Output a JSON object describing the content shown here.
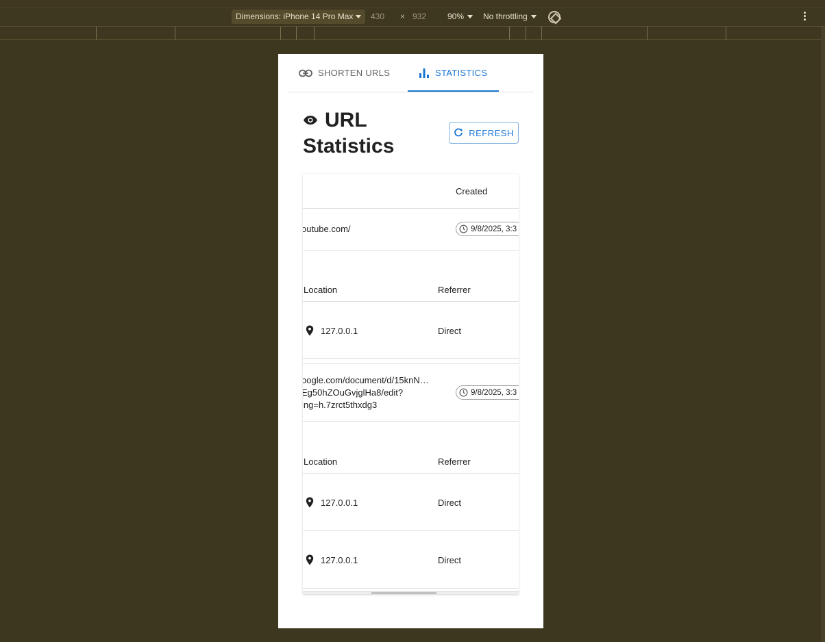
{
  "devtools": {
    "dimensions_label": "Dimensions: iPhone 14 Pro Max",
    "width": "430",
    "times": "×",
    "height": "932",
    "zoom": "90%",
    "throttling": "No throttling"
  },
  "tabs": [
    {
      "label": "SHORTEN URLS",
      "icon": "link-icon"
    },
    {
      "label": "STATISTICS",
      "icon": "bar-chart-icon",
      "active": true
    }
  ],
  "page": {
    "title": "URL Statistics",
    "refresh_label": "REFRESH"
  },
  "table": {
    "header_created": "Created",
    "urls": [
      {
        "original_lines": [
          "outube.com/"
        ],
        "created": "9/8/2025, 3:3",
        "clicks_header": {
          "location": "Location",
          "referrer": "Referrer"
        },
        "clicks": [
          {
            "location": "127.0.0.1",
            "referrer": "Direct"
          }
        ]
      },
      {
        "original_lines": [
          "oogle.com/document/d/15knN…",
          "Eg50hZOuGvjglHa8/edit?",
          "ing=h.7zrct5thxdg3"
        ],
        "created": "9/8/2025, 3:3",
        "clicks_header": {
          "location": "Location",
          "referrer": "Referrer"
        },
        "clicks": [
          {
            "location": "127.0.0.1",
            "referrer": "Direct"
          },
          {
            "location": "127.0.0.1",
            "referrer": "Direct"
          }
        ]
      }
    ]
  },
  "colors": {
    "primary": "#1976d2",
    "devtools_bg": "#3e3720"
  }
}
